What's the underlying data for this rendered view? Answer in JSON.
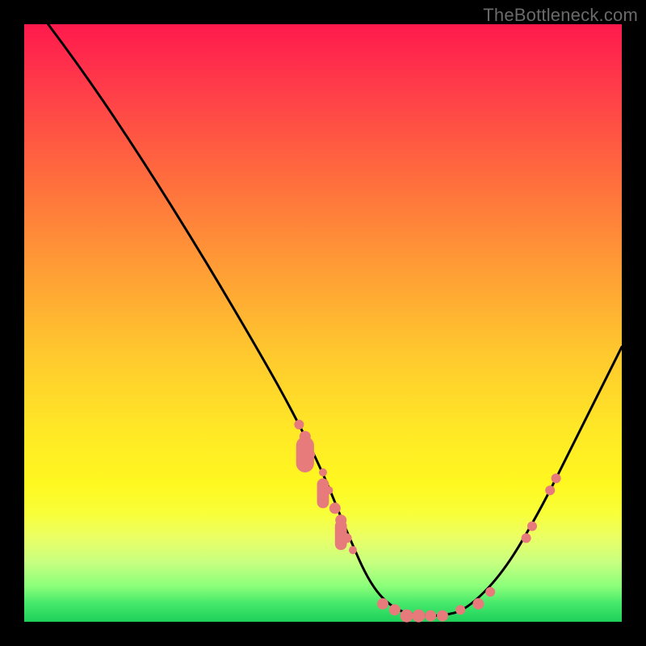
{
  "watermark": "TheBottleneck.com",
  "colors": {
    "bg_black": "#000000",
    "gradient_top": "#ff1a4d",
    "gradient_mid": "#ffe826",
    "gradient_bottom": "#1ed05a",
    "curve": "#000000",
    "dots": "#e77a7a"
  },
  "chart_data": {
    "type": "line",
    "title": "",
    "xlabel": "",
    "ylabel": "",
    "xlim": [
      0,
      100
    ],
    "ylim": [
      0,
      100
    ],
    "curve": [
      {
        "x": 4,
        "y": 100
      },
      {
        "x": 10,
        "y": 92
      },
      {
        "x": 20,
        "y": 77
      },
      {
        "x": 30,
        "y": 61
      },
      {
        "x": 40,
        "y": 44
      },
      {
        "x": 45,
        "y": 35
      },
      {
        "x": 50,
        "y": 25
      },
      {
        "x": 54,
        "y": 15
      },
      {
        "x": 58,
        "y": 6
      },
      {
        "x": 62,
        "y": 2
      },
      {
        "x": 66,
        "y": 1
      },
      {
        "x": 70,
        "y": 1
      },
      {
        "x": 74,
        "y": 2
      },
      {
        "x": 80,
        "y": 8
      },
      {
        "x": 86,
        "y": 18
      },
      {
        "x": 92,
        "y": 30
      },
      {
        "x": 100,
        "y": 46
      }
    ],
    "markers": [
      {
        "x": 46,
        "y": 33,
        "r": 6
      },
      {
        "x": 47,
        "y": 31,
        "r": 7
      },
      {
        "x": 48,
        "y": 28,
        "r": 5
      },
      {
        "x": 50,
        "y": 25,
        "r": 5
      },
      {
        "x": 51,
        "y": 22,
        "r": 5
      },
      {
        "x": 52,
        "y": 19,
        "r": 7
      },
      {
        "x": 53,
        "y": 17,
        "r": 7
      },
      {
        "x": 54,
        "y": 14,
        "r": 6
      },
      {
        "x": 55,
        "y": 12,
        "r": 5
      },
      {
        "x": 60,
        "y": 3,
        "r": 7
      },
      {
        "x": 62,
        "y": 2,
        "r": 7
      },
      {
        "x": 64,
        "y": 1,
        "r": 8
      },
      {
        "x": 66,
        "y": 1,
        "r": 8
      },
      {
        "x": 68,
        "y": 1,
        "r": 7
      },
      {
        "x": 70,
        "y": 1,
        "r": 7
      },
      {
        "x": 73,
        "y": 2,
        "r": 6
      },
      {
        "x": 76,
        "y": 3,
        "r": 7
      },
      {
        "x": 78,
        "y": 5,
        "r": 6
      },
      {
        "x": 84,
        "y": 14,
        "r": 6
      },
      {
        "x": 85,
        "y": 16,
        "r": 6
      },
      {
        "x": 88,
        "y": 22,
        "r": 6
      },
      {
        "x": 89,
        "y": 24,
        "r": 6
      }
    ],
    "smears": [
      {
        "x": 47,
        "y": 31,
        "w": 3,
        "h": 6
      },
      {
        "x": 50,
        "y": 24,
        "w": 2,
        "h": 5
      },
      {
        "x": 53,
        "y": 17,
        "w": 2,
        "h": 5
      }
    ]
  }
}
